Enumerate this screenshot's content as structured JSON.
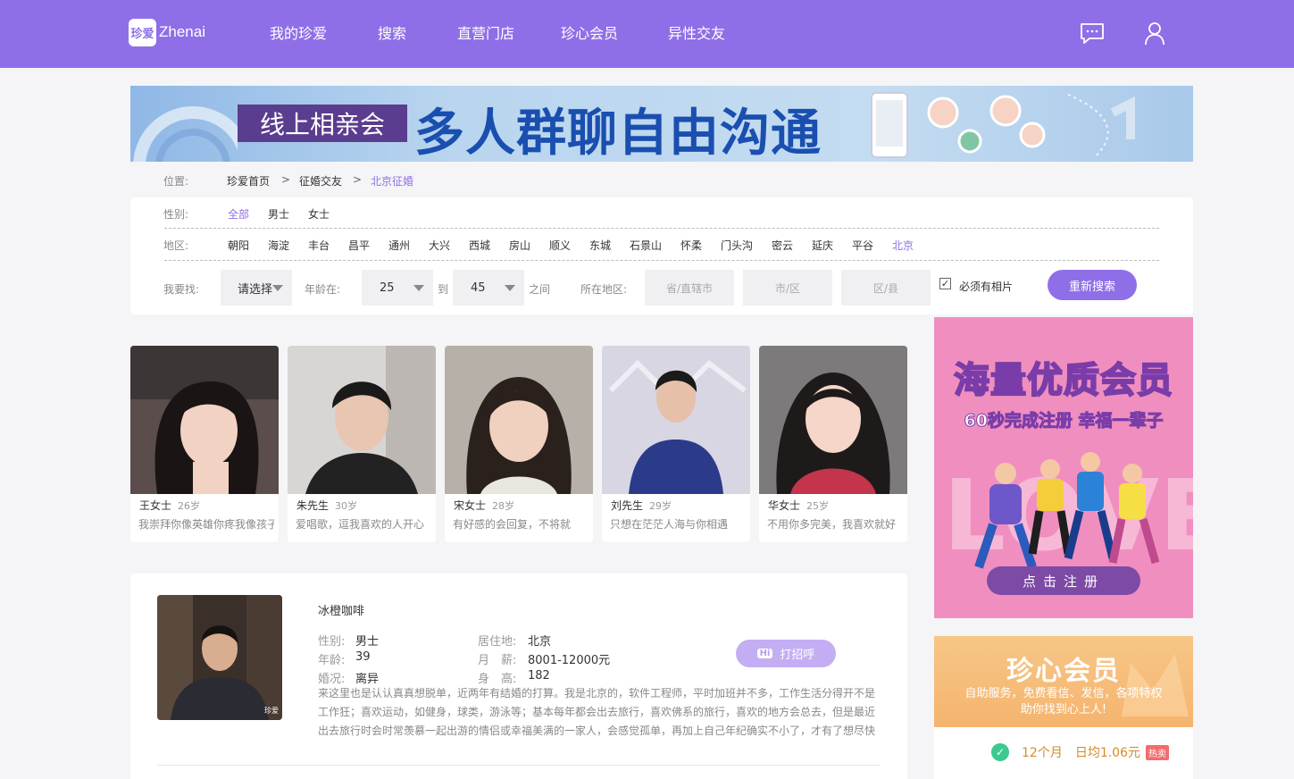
{
  "header": {
    "logo_mark": "珍爱",
    "logo_text": "Zhenai",
    "nav": [
      "我的珍爱",
      "搜索",
      "直营门店",
      "珍心会员",
      "异性交友"
    ]
  },
  "banner": {
    "tag": "线上相亲会",
    "title": "多人群聊自由沟通"
  },
  "breadcrumb": {
    "label": "位置:",
    "items": [
      "珍爱首页",
      "征婚交友",
      "北京征婚"
    ],
    "sep": ">"
  },
  "filter": {
    "gender_label": "性别:",
    "genders": [
      "全部",
      "男士",
      "女士"
    ],
    "district_label": "地区:",
    "districts": [
      "朝阳",
      "海淀",
      "丰台",
      "昌平",
      "通州",
      "大兴",
      "西城",
      "房山",
      "顺义",
      "东城",
      "石景山",
      "怀柔",
      "门头沟",
      "密云",
      "延庆",
      "平谷",
      "北京"
    ],
    "seek_label": "我要找:",
    "seek_value": "请选择",
    "age_label": "年龄在:",
    "age_min": "25",
    "age_to": "到",
    "age_max": "45",
    "age_between": "之间",
    "location_label": "所在地区:",
    "province_placeholder": "省/直辖市",
    "city_placeholder": "市/区",
    "county_placeholder": "区/县",
    "photo_required_label": "必须有相片",
    "photo_required_checked": true,
    "search_button": "重新搜索"
  },
  "cards": [
    {
      "name": "王女士",
      "age": "26岁",
      "motto": "我崇拜你像英雄你疼我像孩子"
    },
    {
      "name": "朱先生",
      "age": "30岁",
      "motto": "爱唱歌，逗我喜欢的人开心"
    },
    {
      "name": "宋女士",
      "age": "28岁",
      "motto": "有好感的会回复，不将就"
    },
    {
      "name": "刘先生",
      "age": "29岁",
      "motto": "只想在茫茫人海与你相遇"
    },
    {
      "name": "华女士",
      "age": "25岁",
      "motto": "不用你多完美，我喜欢就好"
    }
  ],
  "profile": {
    "name": "冰橙咖啡",
    "gender_label": "性别:",
    "gender": "男士",
    "age_label": "年龄:",
    "age": "39",
    "marital_label": "婚况:",
    "marital": "离异",
    "residence_label": "居住地:",
    "residence": "北京",
    "salary_label": "月　薪:",
    "salary": "8001-12000元",
    "height_label": "身　高:",
    "height": "182",
    "greet_badge": "Hi",
    "greet_button": "打招呼",
    "photo_watermark": "珍爱",
    "bio": "来这里也是认认真真想脱单，近两年有结婚的打算。我是北京的，软件工程师，平时加班并不多，工作生活分得开不是工作狂；喜欢运动，如健身，球类，游泳等；基本每年都会出去旅行，喜欢佛系的旅行，喜欢的地方会总去，但是最近出去旅行时会时常羡慕一起出游的情侣或幸福美满的一家人，会感觉孤单，再加上自己年纪确实不小了，才有了想尽快"
  },
  "ad_register": {
    "title": "海量优质会员",
    "subtitle": "60秒完成注册 幸福一辈子",
    "button": "点击注册"
  },
  "ad_vip": {
    "title": "珍心会员",
    "desc1": "自助服务，免费看信、发信，各项特权",
    "desc2": "助你找到心上人!",
    "plan": "12个月　日均1.06元",
    "hot": "热卖"
  },
  "colors": {
    "brand": "#8f6fe8",
    "banner_tag_bg": "#5b3d8f",
    "banner_title": "#1a4fb0",
    "ad_pink": "#f08fbf",
    "ad_orange": "#f5b46f"
  }
}
